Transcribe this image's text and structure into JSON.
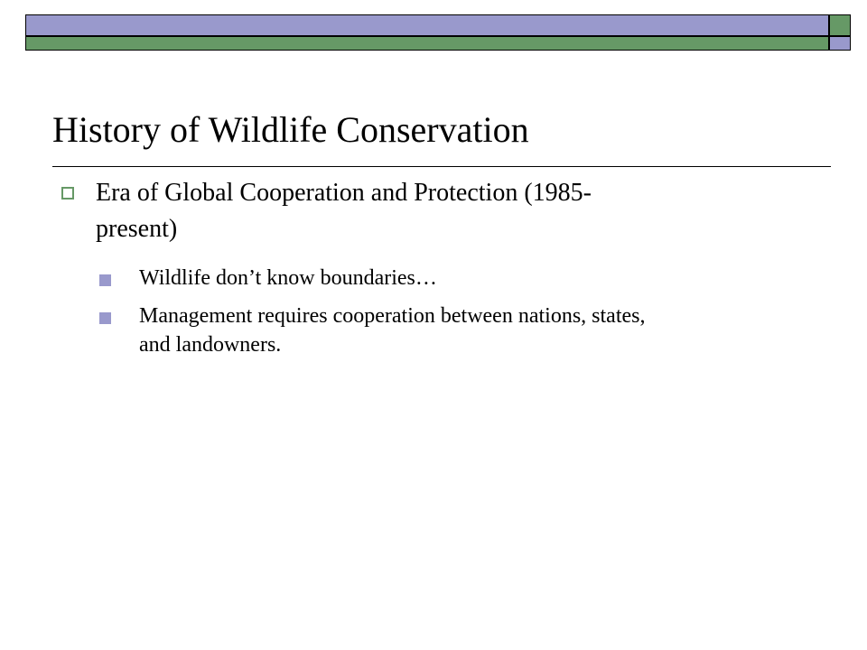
{
  "slide": {
    "title": "History of Wildlife Conservation",
    "bullets": [
      {
        "text": "Era of Global Cooperation and Protection (1985-present)",
        "line1": "Era of Global Cooperation and Protection (1985-",
        "line2": "present)",
        "sub_bullets": [
          {
            "line1": "Wildlife don’t know boundaries…"
          },
          {
            "line1": "Management requires cooperation between nations, states,",
            "line2": "and landowners."
          }
        ]
      }
    ]
  },
  "colors": {
    "accent_blue": "#9999cc",
    "accent_green": "#669966"
  },
  "icons": {
    "level1_bullet": "hollow-square-icon",
    "level2_bullet": "filled-square-icon"
  }
}
